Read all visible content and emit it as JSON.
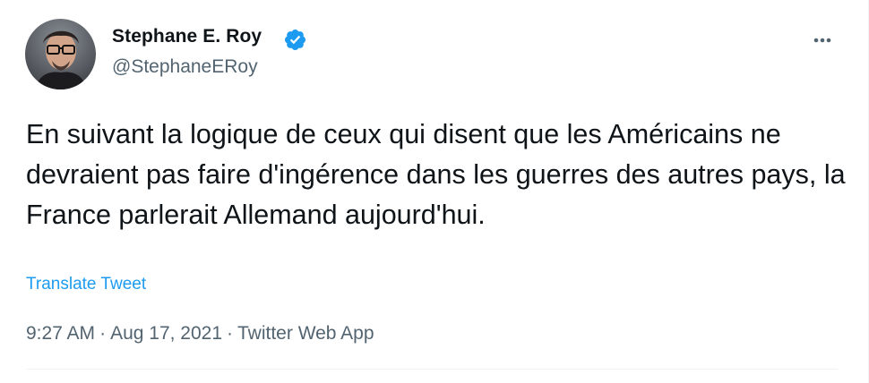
{
  "author": {
    "display_name": "Stephane E. Roy",
    "handle": "@StephaneERoy",
    "verified": true,
    "avatar_icon": "profile-photo"
  },
  "tweet": {
    "text": "En suivant la logique de ceux qui disent que les Américains ne devraient pas faire d'ingérence dans les guerres des autres pays, la France parlerait Allemand aujourd'hui.",
    "translate_label": "Translate Tweet"
  },
  "meta": {
    "time": "9:27 AM",
    "separator": "·",
    "date": "Aug 17, 2021",
    "source": "Twitter Web App"
  },
  "icons": {
    "verified": "verified-badge-icon",
    "more": "more-options-icon"
  },
  "colors": {
    "text": "#0f1419",
    "secondary": "#536471",
    "link": "#1d9bf0",
    "verified": "#1d9bf0",
    "divider": "#eff3f4"
  }
}
